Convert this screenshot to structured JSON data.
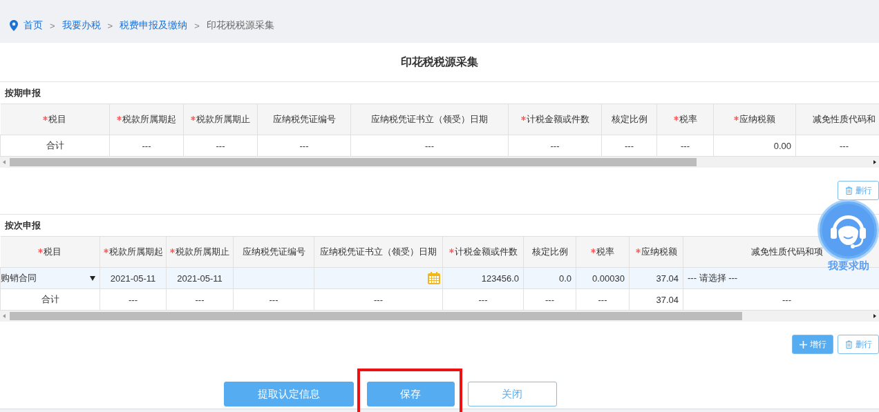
{
  "breadcrumb": [
    {
      "label": "首页",
      "kind": "link"
    },
    {
      "separator": ">",
      "label": "我要办税",
      "kind": "link"
    },
    {
      "separator": ">",
      "label": "税费申报及缴纳",
      "kind": "link"
    },
    {
      "separator": ">",
      "label": "印花税税源采集",
      "kind": "current"
    }
  ],
  "title": "印花税税源采集",
  "sections": [
    {
      "title": "按期申报",
      "columns": [
        {
          "label": "税目",
          "required": true
        },
        {
          "label": "税款所属期起",
          "required": true
        },
        {
          "label": "税款所属期止",
          "required": true
        },
        {
          "label": "应纳税凭证编号",
          "required": false
        },
        {
          "label": "应纳税凭证书立（领受）日期",
          "required": false
        },
        {
          "label": "计税金额或件数",
          "required": true
        },
        {
          "label": "核定比例",
          "required": false
        },
        {
          "label": "税率",
          "required": true
        },
        {
          "label": "应纳税额",
          "required": true
        },
        {
          "label": "减免性质代码和",
          "required": false
        }
      ],
      "rows": [
        {
          "kind": "total",
          "cells": [
            {
              "kind": "text",
              "value": "合计"
            },
            {
              "kind": "text",
              "value": "---"
            },
            {
              "kind": "text",
              "value": "---"
            },
            {
              "kind": "text",
              "value": "---"
            },
            {
              "kind": "text",
              "value": "---"
            },
            {
              "kind": "text",
              "value": "---"
            },
            {
              "kind": "text",
              "value": "---"
            },
            {
              "kind": "text",
              "value": "---"
            },
            {
              "kind": "number",
              "value": "0.00"
            },
            {
              "kind": "text",
              "value": "---"
            }
          ]
        }
      ],
      "actions": [
        {
          "label": "删行",
          "kind": "delete"
        }
      ]
    },
    {
      "title": "按次申报",
      "columns": [
        {
          "label": "税目",
          "required": true
        },
        {
          "label": "税款所属期起",
          "required": true
        },
        {
          "label": "税款所属期止",
          "required": true
        },
        {
          "label": "应纳税凭证编号",
          "required": false
        },
        {
          "label": "应纳税凭证书立（领受）日期",
          "required": false
        },
        {
          "label": "计税金额或件数",
          "required": true
        },
        {
          "label": "核定比例",
          "required": false
        },
        {
          "label": "税率",
          "required": true
        },
        {
          "label": "应纳税额",
          "required": true
        },
        {
          "label": "减免性质代码和项",
          "required": false
        }
      ],
      "rows": [
        {
          "kind": "entry",
          "cells": [
            {
              "kind": "select",
              "value": "购销合同"
            },
            {
              "kind": "text",
              "value": "2021-05-11"
            },
            {
              "kind": "text",
              "value": "2021-05-11"
            },
            {
              "kind": "input"
            },
            {
              "kind": "date"
            },
            {
              "kind": "number",
              "value": "123456.0"
            },
            {
              "kind": "number",
              "value": "0.0"
            },
            {
              "kind": "number",
              "value": "0.00030"
            },
            {
              "kind": "number",
              "value": "37.04"
            },
            {
              "kind": "option",
              "value": "--- 请选择 ---"
            }
          ]
        },
        {
          "kind": "total",
          "cells": [
            {
              "kind": "text",
              "value": "合计"
            },
            {
              "kind": "text",
              "value": "---"
            },
            {
              "kind": "text",
              "value": "---"
            },
            {
              "kind": "text",
              "value": "---"
            },
            {
              "kind": "text",
              "value": "---"
            },
            {
              "kind": "text",
              "value": "---"
            },
            {
              "kind": "text",
              "value": "---"
            },
            {
              "kind": "text",
              "value": "---"
            },
            {
              "kind": "number",
              "value": "37.04"
            },
            {
              "kind": "text",
              "value": "---"
            }
          ]
        }
      ],
      "actions": [
        {
          "label": "增行",
          "kind": "add"
        },
        {
          "label": "删行",
          "kind": "delete"
        }
      ]
    }
  ],
  "buttons": [
    {
      "label": "提取认定信息",
      "kind": "primary",
      "highlighted": false
    },
    {
      "label": "保存",
      "kind": "primary",
      "highlighted": true
    },
    {
      "label": "关闭",
      "kind": "outline",
      "highlighted": false
    }
  ],
  "help": {
    "label": "我要求助"
  }
}
